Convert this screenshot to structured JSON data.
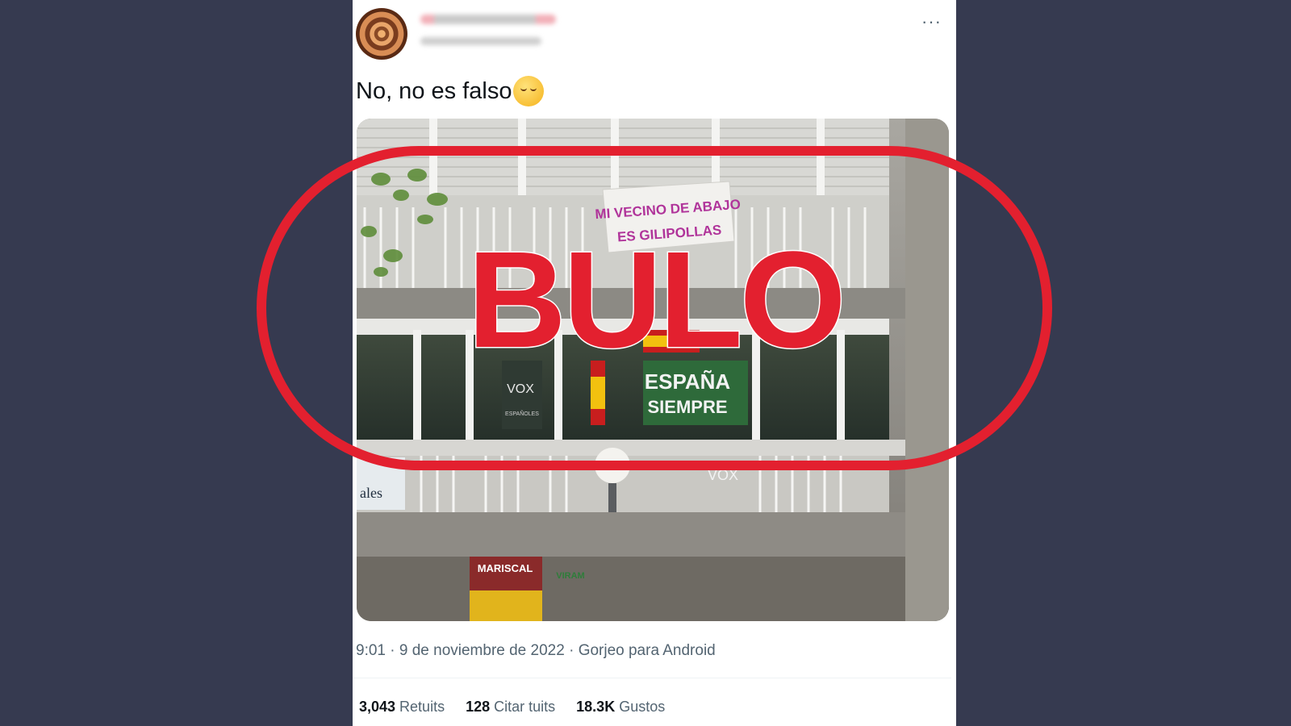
{
  "tweet": {
    "text": "No, no es falso",
    "emoji_icon": "relieved-face-emoji",
    "timestamp": "9:01 · 9 de noviembre de 2022",
    "source": "Gorjeo para Android",
    "more_icon": "more-options-icon"
  },
  "photo": {
    "banner_line1": "MI VECINO DE ABAJO",
    "banner_line2": "ES GILIPOLLAS",
    "poster_line1": "ESPAÑA",
    "poster_line2": "SIEMPRE",
    "vox_logo": "VOX",
    "small_poster_text": "ESPAÑOLES",
    "lower_vox": "VOX",
    "left_sign_text": "ales",
    "shop_sign": "MARISCAL",
    "shop_sign_2": "VIRAM"
  },
  "stats": [
    {
      "value": "3,043",
      "label": "Retuits"
    },
    {
      "value": "128",
      "label": "Citar tuits"
    },
    {
      "value": "18.3K",
      "label": "Gustos"
    }
  ],
  "stamp": {
    "text": "BULO",
    "color": "#e3202f"
  }
}
